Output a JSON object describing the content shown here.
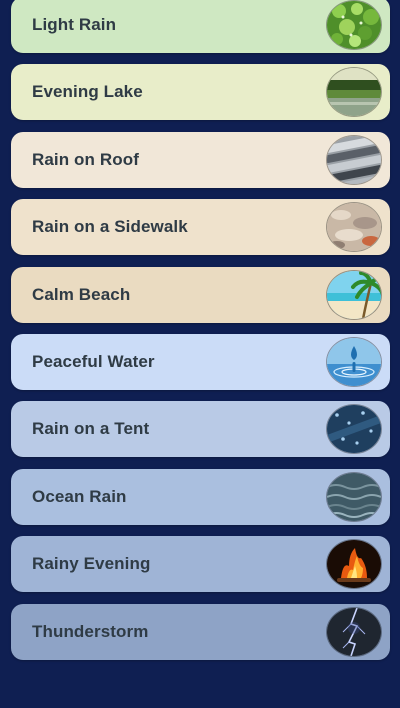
{
  "sounds": [
    {
      "label": "Light Rain",
      "bg": "#cfe8c2",
      "icon": "grass-icon"
    },
    {
      "label": "Evening Lake",
      "bg": "#e8edc9",
      "icon": "lake-icon"
    },
    {
      "label": "Rain on Roof",
      "bg": "#f1e7d8",
      "icon": "roof-icon"
    },
    {
      "label": "Rain on a Sidewalk",
      "bg": "#efe2cc",
      "icon": "sidewalk-icon"
    },
    {
      "label": "Calm Beach",
      "bg": "#eadbc1",
      "icon": "beach-icon"
    },
    {
      "label": "Peaceful Water",
      "bg": "#cbdcf7",
      "icon": "water-drop-icon"
    },
    {
      "label": "Rain on a Tent",
      "bg": "#b9cae6",
      "icon": "tent-icon"
    },
    {
      "label": "Ocean Rain",
      "bg": "#aabfdf",
      "icon": "ocean-icon"
    },
    {
      "label": "Rainy Evening",
      "bg": "#9fb4d6",
      "icon": "fireplace-icon"
    },
    {
      "label": "Thunderstorm",
      "bg": "#8ea3c6",
      "icon": "lightning-icon"
    }
  ]
}
